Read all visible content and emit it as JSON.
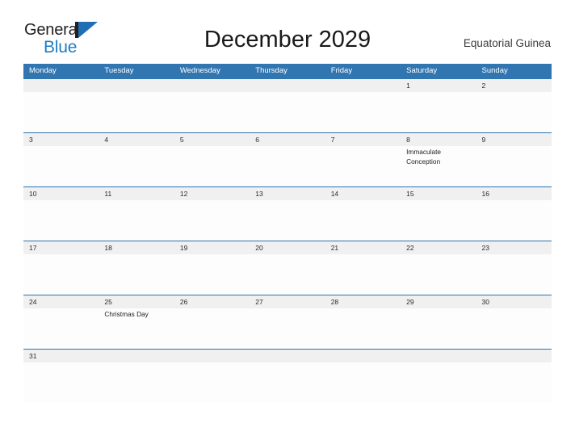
{
  "logo": {
    "word_one": "General",
    "word_two": "Blue",
    "mark": "triangle-flag-icon",
    "color_dark": "#231f20",
    "color_blue": "#1f7dc4"
  },
  "header": {
    "title": "December 2029",
    "country": "Equatorial Guinea"
  },
  "theme": {
    "header_blue": "#3276b1",
    "row_rule_blue": "#2f74ad",
    "date_band_gray": "#f0f0f0",
    "page_background": "#ffffff"
  },
  "calendar": {
    "weekdays": [
      "Monday",
      "Tuesday",
      "Wednesday",
      "Thursday",
      "Friday",
      "Saturday",
      "Sunday"
    ],
    "weeks": [
      {
        "days": [
          {
            "number": "",
            "event": ""
          },
          {
            "number": "",
            "event": ""
          },
          {
            "number": "",
            "event": ""
          },
          {
            "number": "",
            "event": ""
          },
          {
            "number": "",
            "event": ""
          },
          {
            "number": "1",
            "event": ""
          },
          {
            "number": "2",
            "event": ""
          }
        ]
      },
      {
        "days": [
          {
            "number": "3",
            "event": ""
          },
          {
            "number": "4",
            "event": ""
          },
          {
            "number": "5",
            "event": ""
          },
          {
            "number": "6",
            "event": ""
          },
          {
            "number": "7",
            "event": ""
          },
          {
            "number": "8",
            "event": "Immaculate Conception"
          },
          {
            "number": "9",
            "event": ""
          }
        ]
      },
      {
        "days": [
          {
            "number": "10",
            "event": ""
          },
          {
            "number": "11",
            "event": ""
          },
          {
            "number": "12",
            "event": ""
          },
          {
            "number": "13",
            "event": ""
          },
          {
            "number": "14",
            "event": ""
          },
          {
            "number": "15",
            "event": ""
          },
          {
            "number": "16",
            "event": ""
          }
        ]
      },
      {
        "days": [
          {
            "number": "17",
            "event": ""
          },
          {
            "number": "18",
            "event": ""
          },
          {
            "number": "19",
            "event": ""
          },
          {
            "number": "20",
            "event": ""
          },
          {
            "number": "21",
            "event": ""
          },
          {
            "number": "22",
            "event": ""
          },
          {
            "number": "23",
            "event": ""
          }
        ]
      },
      {
        "days": [
          {
            "number": "24",
            "event": ""
          },
          {
            "number": "25",
            "event": "Christmas Day"
          },
          {
            "number": "26",
            "event": ""
          },
          {
            "number": "27",
            "event": ""
          },
          {
            "number": "28",
            "event": ""
          },
          {
            "number": "29",
            "event": ""
          },
          {
            "number": "30",
            "event": ""
          }
        ]
      },
      {
        "days": [
          {
            "number": "31",
            "event": ""
          },
          {
            "number": "",
            "event": ""
          },
          {
            "number": "",
            "event": ""
          },
          {
            "number": "",
            "event": ""
          },
          {
            "number": "",
            "event": ""
          },
          {
            "number": "",
            "event": ""
          },
          {
            "number": "",
            "event": ""
          }
        ]
      }
    ]
  }
}
